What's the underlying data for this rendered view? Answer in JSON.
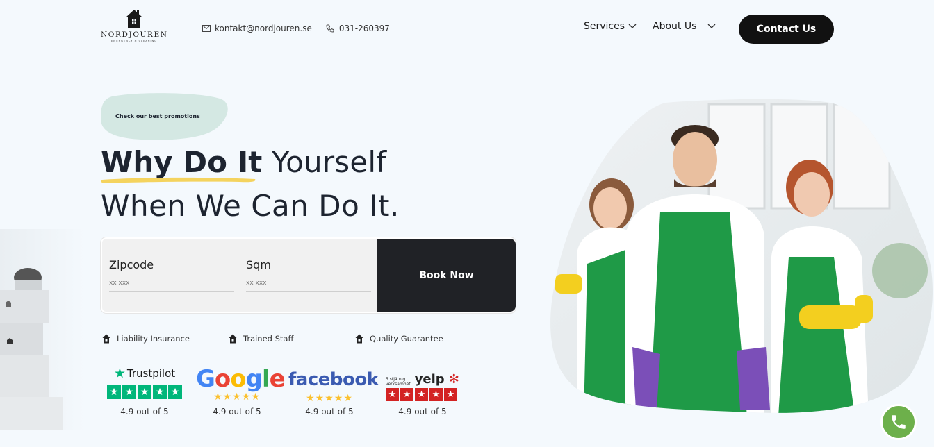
{
  "header": {
    "logo": {
      "name": "NORDJOUREN",
      "tagline": "EMERGENCY & CLEANING"
    },
    "email": "kontakt@nordjouren.se",
    "phone": "031-260397",
    "nav": [
      {
        "label": "Services"
      },
      {
        "label": "About Us"
      }
    ],
    "cta_label": "Contact Us"
  },
  "hero": {
    "promo": "Check our best promotions",
    "headline_bold": "Why Do It",
    "headline_light": " Yourself",
    "headline_line2": "When We Can Do It."
  },
  "form": {
    "zipcode_label": "Zipcode",
    "zipcode_placeholder": "xx xxx",
    "sqm_label": "Sqm",
    "sqm_placeholder": "xx xxx",
    "book_label": "Book Now"
  },
  "features": [
    {
      "label": "Liability Insurance",
      "icon": "house-icon"
    },
    {
      "label": "Trained Staff",
      "icon": "house-icon"
    },
    {
      "label": "Quality Guarantee",
      "icon": "house-icon"
    }
  ],
  "ratings": [
    {
      "brand": "Trustpilot",
      "score": "4.9 out of 5"
    },
    {
      "brand": "Google",
      "score": "4.9 out of 5"
    },
    {
      "brand": "facebook",
      "score": "4.9 out of 5"
    },
    {
      "brand": "yelp",
      "badge_line1": "5 stjärnig",
      "badge_line2": "verksamhet",
      "score": "4.9 out of 5"
    }
  ],
  "colors": {
    "accent_dark": "#111111",
    "book_button": "#202226",
    "highlight": "#f4d35e",
    "promo_blob": "#d4e8e3",
    "apron_green": "#1f9a47",
    "phone_green": "#6db04b",
    "trustpilot": "#00b67a",
    "yelp": "#d32323",
    "facebook": "#3b5bb1"
  }
}
